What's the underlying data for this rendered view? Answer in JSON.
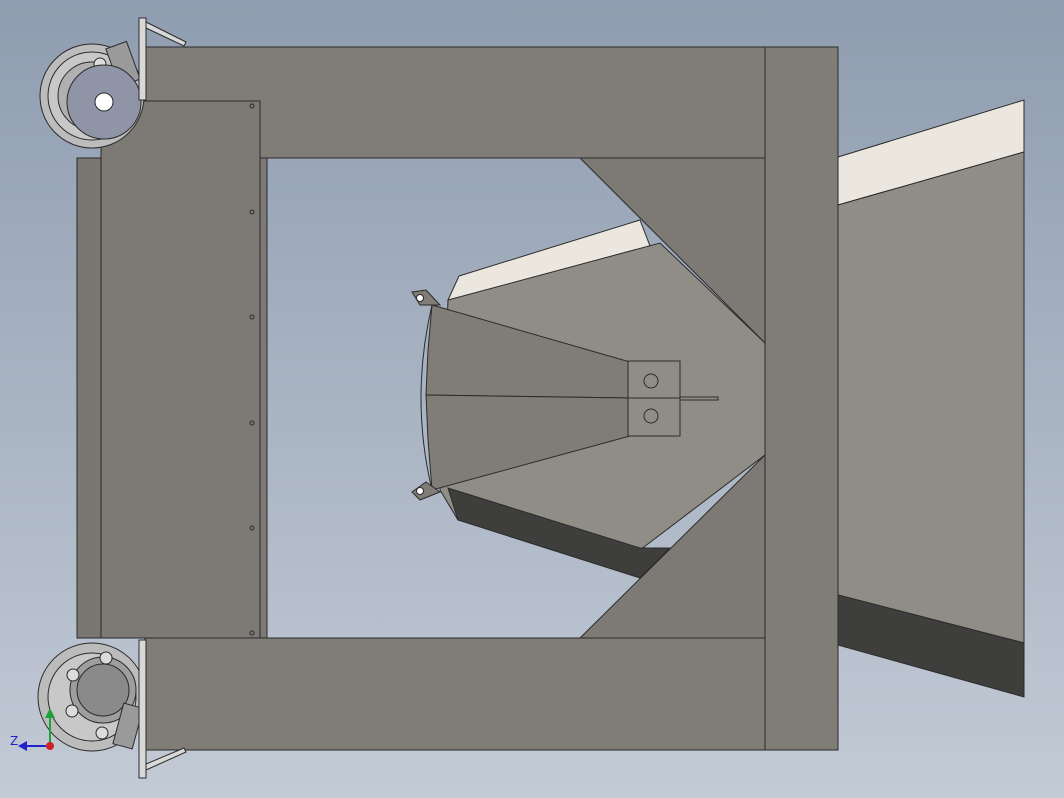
{
  "viewport": {
    "background_top": "#8f9db0",
    "background_bottom": "#c2cad5"
  },
  "triad": {
    "z_label": "Z",
    "z_color": "#2222cc",
    "y_color": "#1fa13a",
    "x_color": "#cc2222"
  },
  "model": {
    "frame_color": "#807c76",
    "panel_color": "#7d7974",
    "edge_color": "#2b2b2b",
    "chute_light": "#908d87",
    "chute_top": "#ebe7df",
    "chute_shadow": "#3e3e3c",
    "wheel_color": "#bcbcbc",
    "hub_color": "#8f95a6"
  }
}
